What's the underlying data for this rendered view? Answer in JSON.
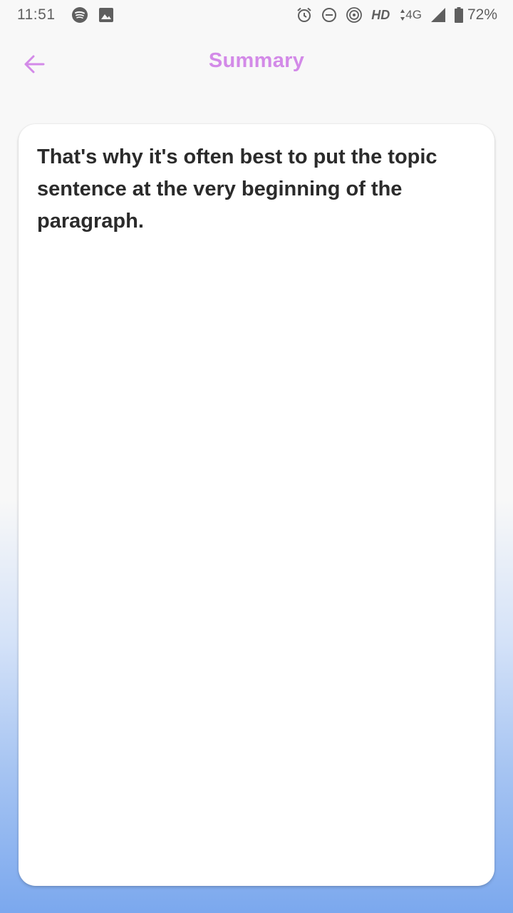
{
  "status_bar": {
    "time": "11:51",
    "hd": "HD",
    "network": "4G",
    "battery": "72%",
    "icons": [
      "spotify-icon",
      "image-icon",
      "alarm-icon",
      "do-not-disturb-icon",
      "hotspot-icon",
      "signal-icon",
      "battery-icon"
    ]
  },
  "header": {
    "title": "Summary",
    "back_icon": "arrow-left-icon",
    "accent_color": "#d38ae8"
  },
  "summary": {
    "text": "That's why it's often best to put the topic sentence at the very beginning of the paragraph."
  }
}
